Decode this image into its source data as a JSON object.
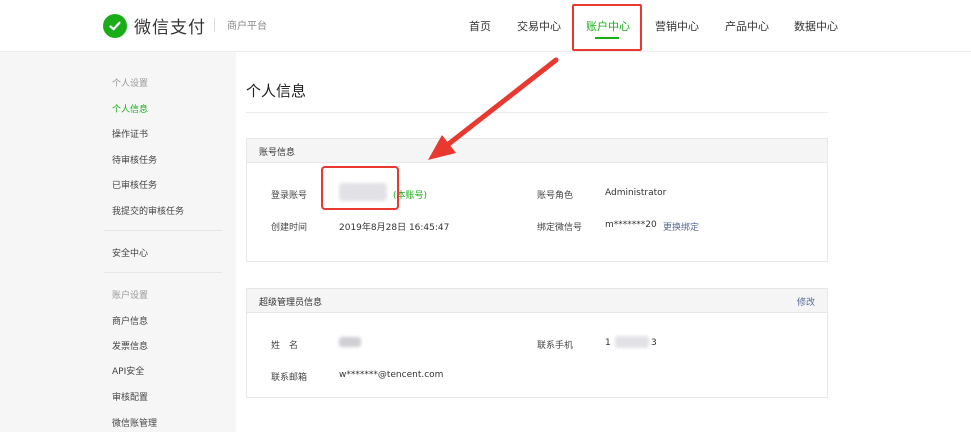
{
  "header": {
    "brand": "微信支付",
    "subbrand": "商户平台",
    "nav": [
      {
        "label": "首页",
        "active": false
      },
      {
        "label": "交易中心",
        "active": false
      },
      {
        "label": "账户中心",
        "active": true
      },
      {
        "label": "营销中心",
        "active": false
      },
      {
        "label": "产品中心",
        "active": false
      },
      {
        "label": "数据中心",
        "active": false
      }
    ]
  },
  "sidebar": {
    "personal_group": "个人设置",
    "personal_items": [
      "个人信息",
      "操作证书",
      "待审核任务",
      "已审核任务",
      "我提交的审核任务"
    ],
    "security": "安全中心",
    "account_group": "账户设置",
    "account_items": [
      "商户信息",
      "发票信息",
      "API安全",
      "审核配置",
      "微信账管理"
    ]
  },
  "main": {
    "title": "个人信息",
    "account_panel": {
      "title": "账号信息",
      "login_label": "登录账号",
      "login_suffix": "(本账号)",
      "role_label": "账号角色",
      "role_value": "Administrator",
      "created_label": "创建时间",
      "created_value": "2019年8月28日 16:45:47",
      "wechat_label": "绑定微信号",
      "wechat_value": "m*******20",
      "wechat_link": "更换绑定"
    },
    "admin_panel": {
      "title": "超级管理员信息",
      "edit": "修改",
      "name_label": "姓　名",
      "phone_label": "联系手机",
      "phone_prefix": "1",
      "phone_suffix": "3",
      "email_label": "联系邮箱",
      "email_value": "w*******@tencent.com"
    }
  },
  "colors": {
    "accent": "#1aad19",
    "link": "#576b95",
    "annotation": "#e8382f"
  }
}
